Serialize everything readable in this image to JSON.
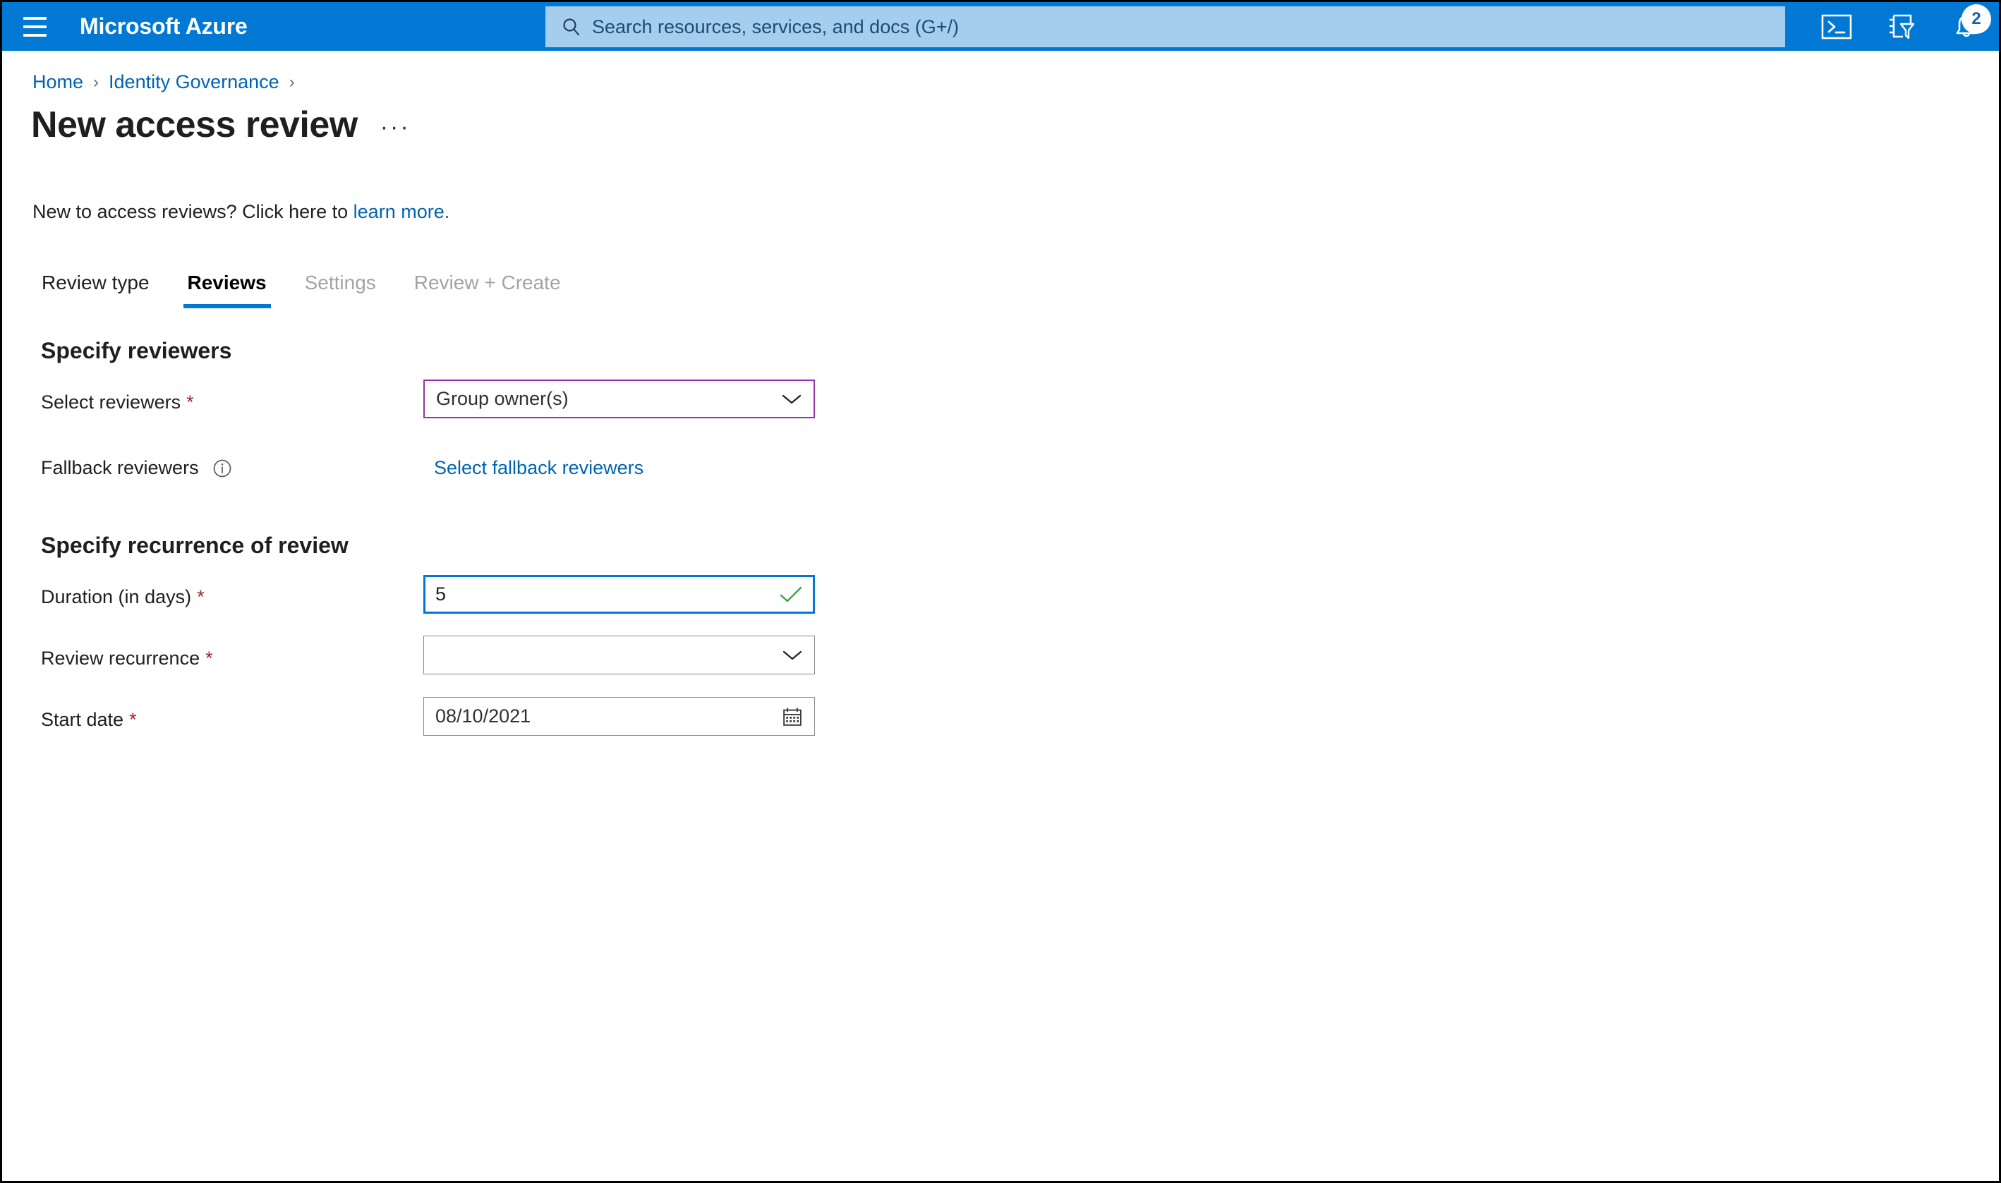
{
  "topbar": {
    "menu_icon": "hamburger-menu-icon",
    "brand": "Microsoft Azure",
    "search": {
      "icon": "search-icon",
      "placeholder": "Search resources, services, and docs (G+/)",
      "value": ""
    },
    "actions": [
      {
        "name": "cloud-shell-icon",
        "label": "Cloud Shell"
      },
      {
        "name": "directory-filter-icon",
        "label": "Directories + subscriptions"
      },
      {
        "name": "notifications-bell-icon",
        "label": "Notifications",
        "badge": "2"
      }
    ],
    "accent_color": "#0078D4",
    "search_bg": "#A5CEEE"
  },
  "breadcrumb": {
    "items": [
      {
        "label": "Home"
      },
      {
        "label": "Identity Governance"
      }
    ],
    "separator": "›",
    "trailing_separator": "›",
    "link_color": "#0063B1"
  },
  "header": {
    "title": "New access review",
    "more_actions": "···"
  },
  "intro": {
    "text_before": "New to access reviews? Click here to ",
    "link_text": "learn more.",
    "link_color": "#0063B1"
  },
  "tabs": [
    {
      "label": "Review type",
      "state": "enabled"
    },
    {
      "label": "Reviews",
      "state": "active"
    },
    {
      "label": "Settings",
      "state": "disabled"
    },
    {
      "label": "Review + Create",
      "state": "disabled"
    }
  ],
  "sections": [
    {
      "heading": "Specify reviewers",
      "fields": [
        {
          "label": "Select reviewers",
          "required": true,
          "type": "select",
          "value": "Group owner(s)",
          "border_color": "#9B30B0"
        },
        {
          "label": "Fallback reviewers",
          "required": false,
          "type": "link",
          "info_icon": "info-icon",
          "link_text": "Select fallback reviewers"
        }
      ]
    },
    {
      "heading": "Specify recurrence of review",
      "fields": [
        {
          "label": "Duration (in days)",
          "required": true,
          "type": "text",
          "value": "5",
          "placeholder": "",
          "validation": "valid",
          "validation_icon": "checkmark-icon",
          "validation_color": "#3DA43D",
          "border_color": "#0078D4",
          "focused": true
        },
        {
          "label": "Review recurrence",
          "required": true,
          "type": "select",
          "value": "",
          "border_color": "#8A8886"
        },
        {
          "label": "Start date",
          "required": true,
          "type": "date",
          "value": "08/10/2021",
          "trailing_icon": "calendar-icon",
          "border_color": "#8A8886"
        }
      ]
    }
  ],
  "required_marker": "*",
  "required_color": "#A4262C"
}
